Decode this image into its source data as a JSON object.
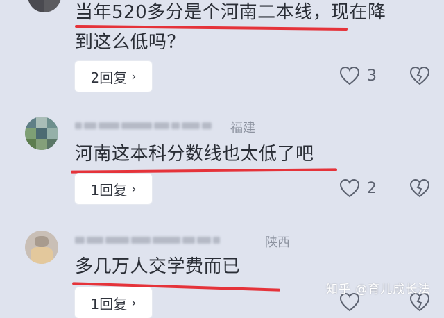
{
  "comments": [
    {
      "region": "",
      "text_line1": "当年520多分是个河南二本线，现在降",
      "text_line2": "到这么低吗？",
      "reply_label": "2回复",
      "likes": "3"
    },
    {
      "region": "福建",
      "text_line1": "河南这本科分数线也太低了吧",
      "reply_label": "1回复",
      "likes": "2"
    },
    {
      "region": "陕西",
      "text_line1": "多几万人交学费而已",
      "reply_label": "1回复",
      "likes": ""
    }
  ],
  "watermark": "知乎 @育儿成长法",
  "colors": {
    "background": "#dfe3ee",
    "underline": "#e5333a",
    "card": "#ffffff"
  },
  "icons": [
    "heart-icon",
    "broken-heart-icon",
    "chevron-right-icon"
  ]
}
